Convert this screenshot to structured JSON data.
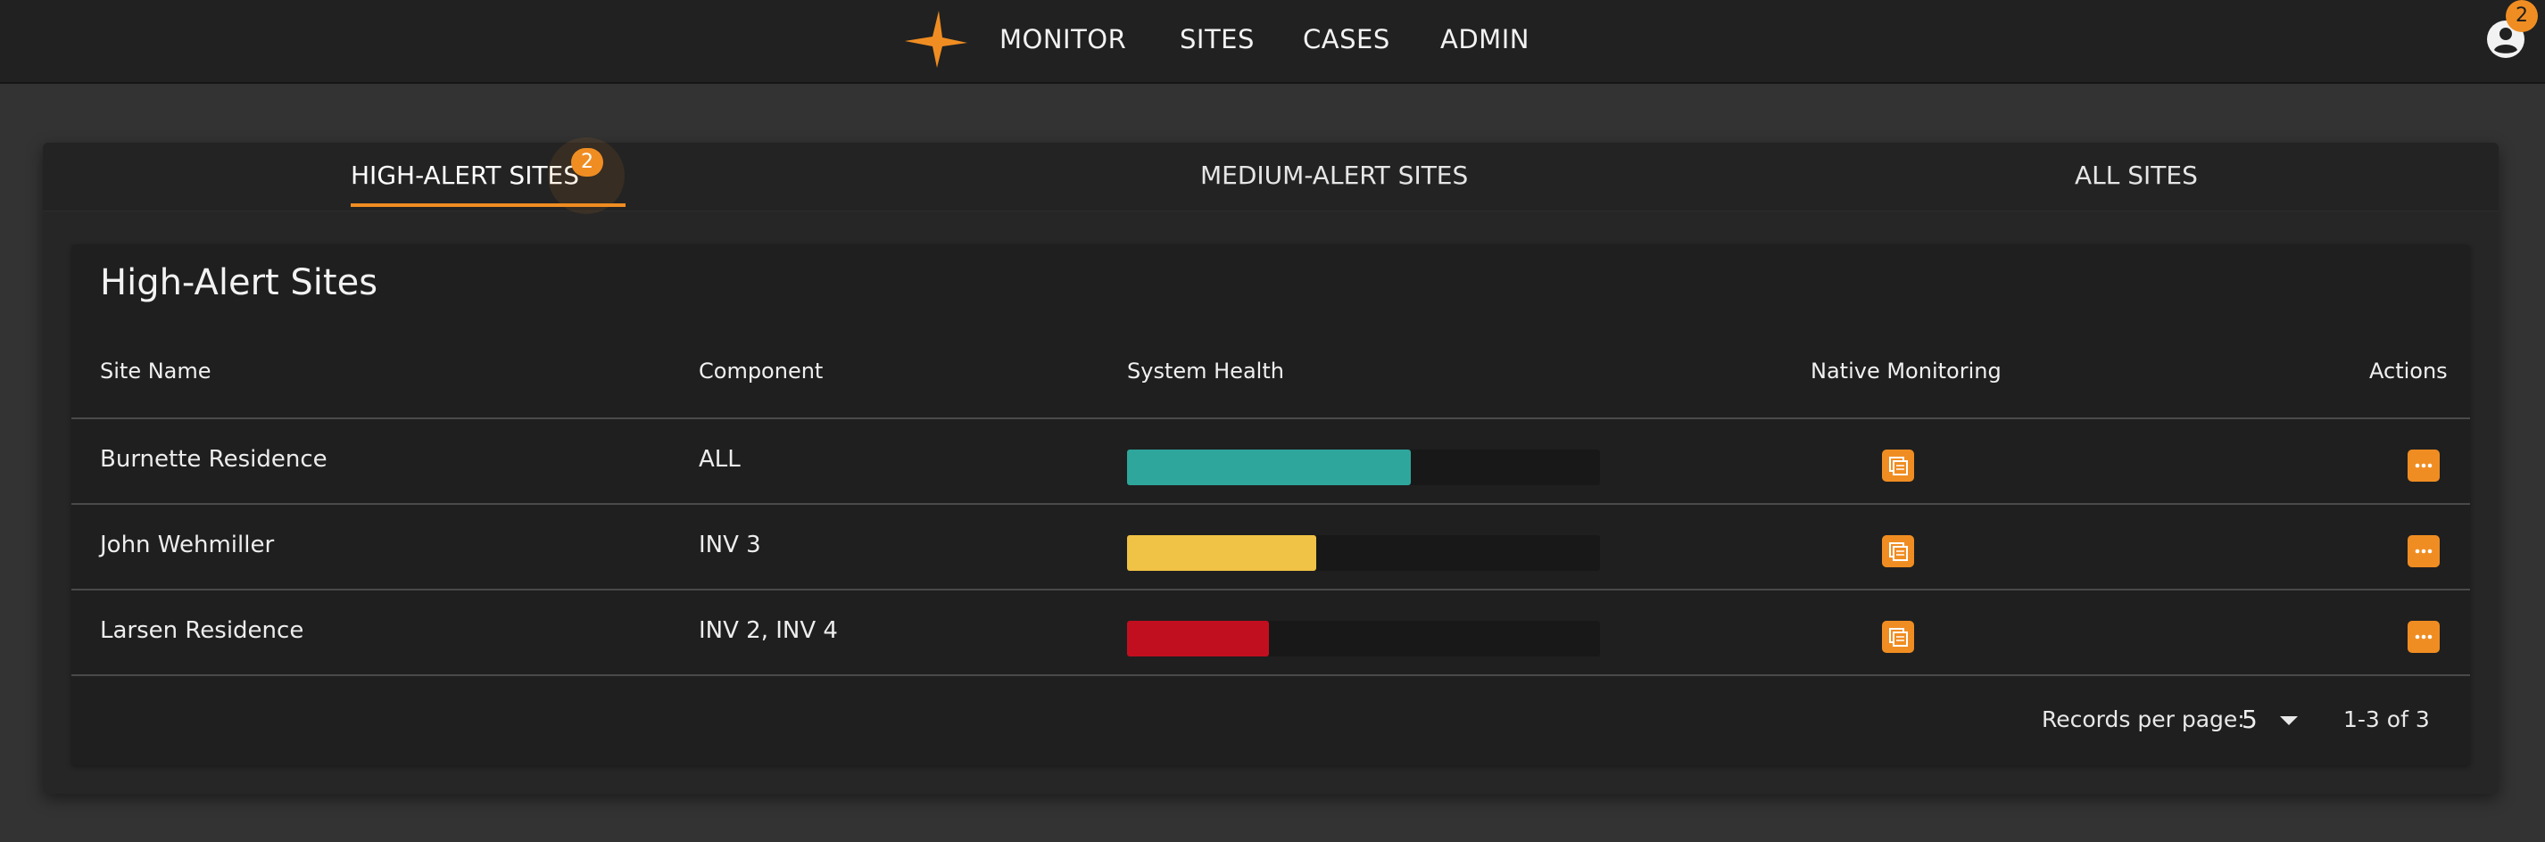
{
  "nav": {
    "items": [
      {
        "label": "MONITOR"
      },
      {
        "label": "SITES"
      },
      {
        "label": "CASES"
      },
      {
        "label": "ADMIN"
      }
    ],
    "logo_icon": "orange-star-logo",
    "account_icon": "account-circle-icon",
    "notification_count": "2"
  },
  "tabs": {
    "items": [
      {
        "label": "HIGH-ALERT SITES",
        "active": true
      },
      {
        "label": "MEDIUM-ALERT SITES",
        "active": false
      },
      {
        "label": "ALL SITES",
        "active": false
      }
    ],
    "high_alert_badge": "2"
  },
  "table": {
    "title": "High-Alert Sites",
    "columns": {
      "site_name": "Site Name",
      "component": "Component",
      "system_health": "System Health",
      "native_monitoring": "Native Monitoring",
      "actions": "Actions"
    },
    "rows": [
      {
        "site_name": "Burnette Residence",
        "component": "ALL",
        "health_pct": 60,
        "health_color": "#2ea69b"
      },
      {
        "site_name": "John Wehmiller",
        "component": "INV 3",
        "health_pct": 40,
        "health_color": "#f0c245"
      },
      {
        "site_name": "Larsen Residence",
        "component": "INV 2, INV 4",
        "health_pct": 30,
        "health_color": "#c20f1f"
      }
    ],
    "native_monitoring_icon": "external-monitor-icon",
    "actions_icon": "more-horizontal-icon"
  },
  "pagination": {
    "records_per_page_label": "Records per page:",
    "records_per_page_value": "5",
    "range_text": "1-3 of 3"
  },
  "colors": {
    "accent": "#f08d22",
    "background": "#333333",
    "topbar": "#212121"
  }
}
